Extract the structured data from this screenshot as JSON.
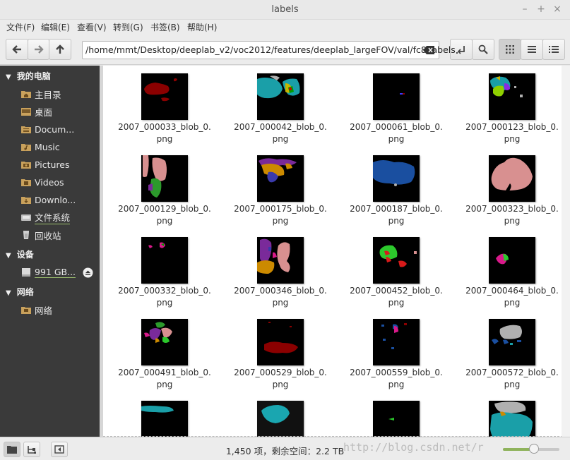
{
  "window": {
    "title": "labels"
  },
  "menu": [
    "文件(F)",
    "编辑(E)",
    "查看(V)",
    "转到(G)",
    "书签(B)",
    "帮助(H)"
  ],
  "path": {
    "value": "/home/mmt/Desktop/deeplab_v2/voc2012/features/deeplab_largeFOV/val/fc8/labels"
  },
  "sidebar": {
    "sections": [
      {
        "title": "我的电脑",
        "items": [
          "主目录",
          "桌面",
          "Docum...",
          "Music",
          "Pictures",
          "Videos",
          "Downlo...",
          "文件系统",
          "回收站"
        ]
      },
      {
        "title": "设备",
        "items": [
          "991 GB..."
        ]
      },
      {
        "title": "网络",
        "items": [
          "网络"
        ]
      }
    ]
  },
  "files": [
    {
      "l1": "2007_000033_blob_0.",
      "l2": "png"
    },
    {
      "l1": "2007_000042_blob_0.",
      "l2": "png"
    },
    {
      "l1": "2007_000061_blob_0.",
      "l2": "png"
    },
    {
      "l1": "2007_000123_blob_0.",
      "l2": "png"
    },
    {
      "l1": "2007_000129_blob_0.",
      "l2": "png"
    },
    {
      "l1": "2007_000175_blob_0.",
      "l2": "png"
    },
    {
      "l1": "2007_000187_blob_0.",
      "l2": "png"
    },
    {
      "l1": "2007_000323_blob_0.",
      "l2": "png"
    },
    {
      "l1": "2007_000332_blob_0.",
      "l2": "png"
    },
    {
      "l1": "2007_000346_blob_0.",
      "l2": "png"
    },
    {
      "l1": "2007_000452_blob_0.",
      "l2": "png"
    },
    {
      "l1": "2007_000464_blob_0.",
      "l2": "png"
    },
    {
      "l1": "2007_000491_blob_0.",
      "l2": "png"
    },
    {
      "l1": "2007_000529_blob_0.",
      "l2": "png"
    },
    {
      "l1": "2007_000559_blob_0.",
      "l2": "png"
    },
    {
      "l1": "2007_000572_blob_0.",
      "l2": "png"
    }
  ],
  "status": {
    "text": "1,450 项，剩余空间：2.2 TB",
    "zoom_level": 0.55
  },
  "watermark": "http://blog.csdn.net/r"
}
